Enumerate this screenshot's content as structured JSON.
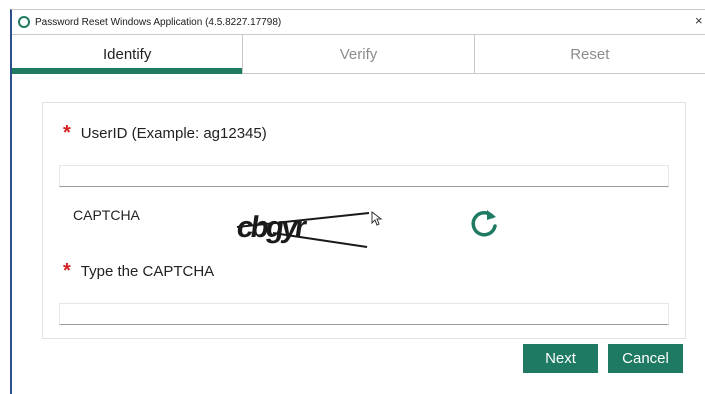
{
  "window": {
    "title": "Password Reset Windows Application (4.5.8227.17798)",
    "close_glyph": "×"
  },
  "tabs": [
    {
      "label": "Identify",
      "active": true
    },
    {
      "label": "Verify",
      "active": false
    },
    {
      "label": "Reset",
      "active": false
    }
  ],
  "form": {
    "required_marker": "*",
    "userid_label": "UserID (Example: ag12345)",
    "userid_value": "",
    "captcha_label": "CAPTCHA",
    "captcha_text": "cbgyr",
    "captcha_input_label": "Type the CAPTCHA",
    "captcha_input_value": ""
  },
  "buttons": {
    "next_label": "Next",
    "cancel_label": "Cancel"
  },
  "colors": {
    "accent": "#1e7a62",
    "required": "#d42020",
    "title_border": "#2a4f8a"
  },
  "icons": {
    "app": "app-logo-icon",
    "refresh": "refresh-icon",
    "cursor": "mouse-pointer-icon"
  }
}
